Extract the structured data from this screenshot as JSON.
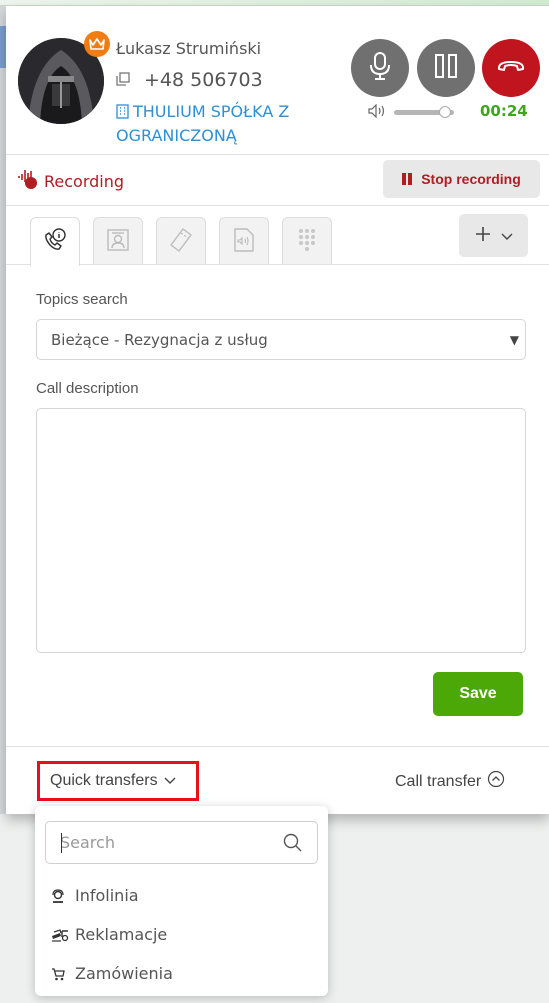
{
  "caller": {
    "name": "Łukasz Strumiński",
    "phone": "+48 506703",
    "company": "THULIUM SPÓŁKA Z OGRANICZONĄ",
    "badge_icon": "crown-icon",
    "avatar_icon": "avatar-image"
  },
  "call_controls": {
    "mic_icon": "microphone-icon",
    "hold_icon": "pause-icon",
    "hangup_icon": "hang-up-icon",
    "volume_level": 0.85,
    "timer": "00:24",
    "colors": {
      "hangup": "#c0151f",
      "timer": "#3fa51c",
      "control": "#707070"
    }
  },
  "recording": {
    "status_label": "Recording",
    "stop_label": "Stop recording",
    "color": "#b01d23"
  },
  "tabs": [
    {
      "icon": "phone-info-icon",
      "active": true
    },
    {
      "icon": "contact-card-icon",
      "active": false
    },
    {
      "icon": "ticket-icon",
      "active": false
    },
    {
      "icon": "audio-file-icon",
      "active": false
    },
    {
      "icon": "dialpad-icon",
      "active": false
    }
  ],
  "add_menu": {
    "icon": "plus-icon",
    "chevron": "chevron-down-icon"
  },
  "form": {
    "topics_label": "Topics search",
    "topics_value": "Bieżące - Rezygnacja z usług",
    "description_label": "Call description",
    "description_value": "",
    "save_label": "Save",
    "save_color": "#4ca807"
  },
  "footer": {
    "quick_transfers_label": "Quick transfers",
    "call_transfer_label": "Call transfer"
  },
  "quick_dropdown": {
    "search_placeholder": "Search",
    "items": [
      {
        "label": "Infolinia",
        "icon": "headset-agent-icon"
      },
      {
        "label": "Reklamacje",
        "icon": "complaint-icon"
      },
      {
        "label": "Zamówienia",
        "icon": "cart-icon"
      }
    ]
  }
}
